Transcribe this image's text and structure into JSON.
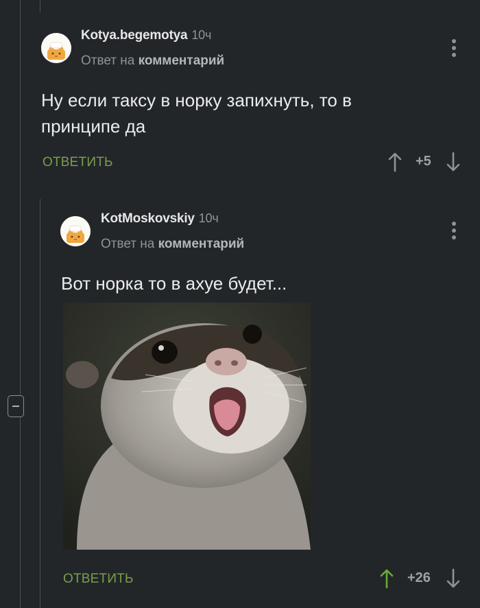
{
  "comments": [
    {
      "author": "Kotya.begemotya",
      "time": "10ч",
      "reply_prefix": "Ответ на",
      "reply_link": "комментарий",
      "text_line1": "Ну если таксу в норку запихнуть, то в",
      "text_line2": "принципе да",
      "reply_label": "ОТВЕТИТЬ",
      "score": "+5"
    },
    {
      "author": "KotMoskovskiy",
      "time": "10ч",
      "reply_prefix": "Ответ на",
      "reply_link": "комментарий",
      "text_line1": "Вот норка то в ахуе будет...",
      "reply_label": "ОТВЕТИТЬ",
      "score": "+26"
    }
  ],
  "icons": {
    "upvote": "arrow-up-icon",
    "downvote": "arrow-down-icon",
    "more": "more-vertical-icon",
    "collapse": "minus-icon"
  },
  "colors": {
    "background": "#232629",
    "accent_green": "#7b9d4d",
    "upvote_active": "#6bad2f"
  }
}
